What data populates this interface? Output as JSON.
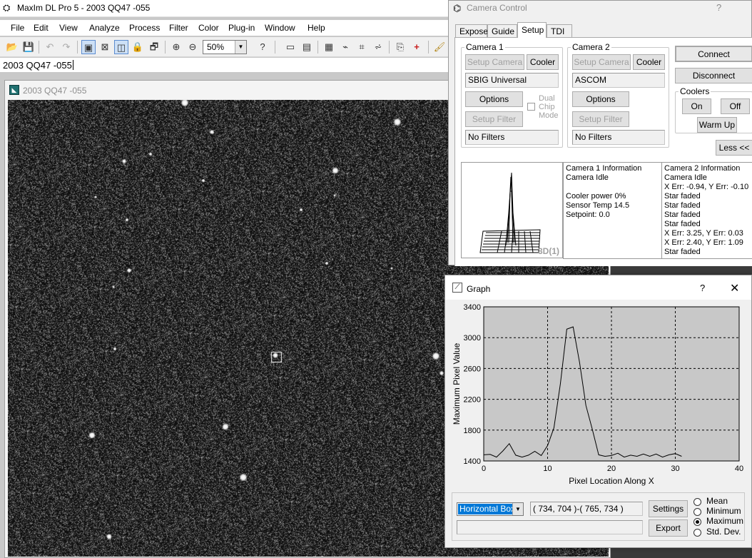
{
  "app": {
    "title": "MaxIm DL Pro 5 - 2003 QQ47 -055",
    "menu": [
      "File",
      "Edit",
      "View",
      "Analyze",
      "Process",
      "Filter",
      "Color",
      "Plug-in",
      "Window",
      "Help"
    ],
    "zoom": "50%",
    "document_label": "2003 QQ47 -055"
  },
  "image_window": {
    "title": "2003 QQ47 -055"
  },
  "camera_control": {
    "title": "Camera Control",
    "help": "?",
    "tabs": [
      "Expose",
      "Guide",
      "Setup",
      "TDI"
    ],
    "active_tab": "Setup",
    "camera1": {
      "legend": "Camera 1",
      "setup_camera": "Setup Camera",
      "cooler": "Cooler",
      "model": "SBIG Universal",
      "options": "Options",
      "dual_chip_mode": "Dual\nChip\nMode",
      "setup_filter": "Setup Filter",
      "filters": "No Filters"
    },
    "camera2": {
      "legend": "Camera 2",
      "setup_camera": "Setup Camera",
      "cooler": "Cooler",
      "model": "ASCOM",
      "options": "Options",
      "setup_filter": "Setup Filter",
      "filters": "No Filters"
    },
    "connect": "Connect",
    "disconnect": "Disconnect",
    "coolers": {
      "legend": "Coolers",
      "on": "On",
      "off": "Off",
      "warm_up": "Warm Up"
    },
    "less": "Less <<",
    "preview_label": "3D(1)",
    "camera1_info": "Camera 1 Information\nCamera Idle\n\nCooler power 0%\nSensor Temp 14.5\nSetpoint: 0.0",
    "camera2_info": "Camera 2 Information\nCamera Idle\nX Err: -0.94, Y Err: -0.10\nStar faded\nStar faded\nStar faded\nStar faded\nX Err: 3.25, Y Err: 0.03\nX Err: 2.40, Y Err: 1.09\nStar faded"
  },
  "graph": {
    "title": "Graph",
    "help": "?",
    "close": "✕",
    "mode": "Horizontal Box",
    "range": "( 734, 704 )-( 765, 734 )",
    "settings": "Settings",
    "export": "Export",
    "stats": [
      "Mean",
      "Minimum",
      "Maximum",
      "Std. Dev."
    ],
    "selected_stat": "Maximum"
  },
  "chart_data": {
    "type": "line",
    "xlabel": "Pixel Location Along X",
    "ylabel": "Maximum Pixel Value",
    "xlim": [
      0,
      40
    ],
    "ylim": [
      1400,
      3400
    ],
    "xticks": [
      0,
      10,
      20,
      30,
      40
    ],
    "yticks": [
      1400,
      1800,
      2200,
      2600,
      3000,
      3400
    ],
    "grid": true,
    "series": [
      {
        "x": [
          0,
          1,
          2,
          3,
          4,
          5,
          6,
          7,
          8,
          9,
          10,
          11,
          12,
          13,
          14,
          15,
          16,
          17,
          18,
          19,
          20,
          21,
          22,
          23,
          24,
          25,
          26,
          27,
          28,
          29,
          30,
          31
        ],
        "values": [
          1480,
          1485,
          1450,
          1530,
          1625,
          1475,
          1450,
          1475,
          1525,
          1470,
          1600,
          1830,
          2400,
          3110,
          3140,
          2680,
          2120,
          1810,
          1480,
          1460,
          1470,
          1500,
          1450,
          1475,
          1460,
          1490,
          1460,
          1490,
          1450,
          1480,
          1495,
          1460
        ]
      }
    ]
  }
}
